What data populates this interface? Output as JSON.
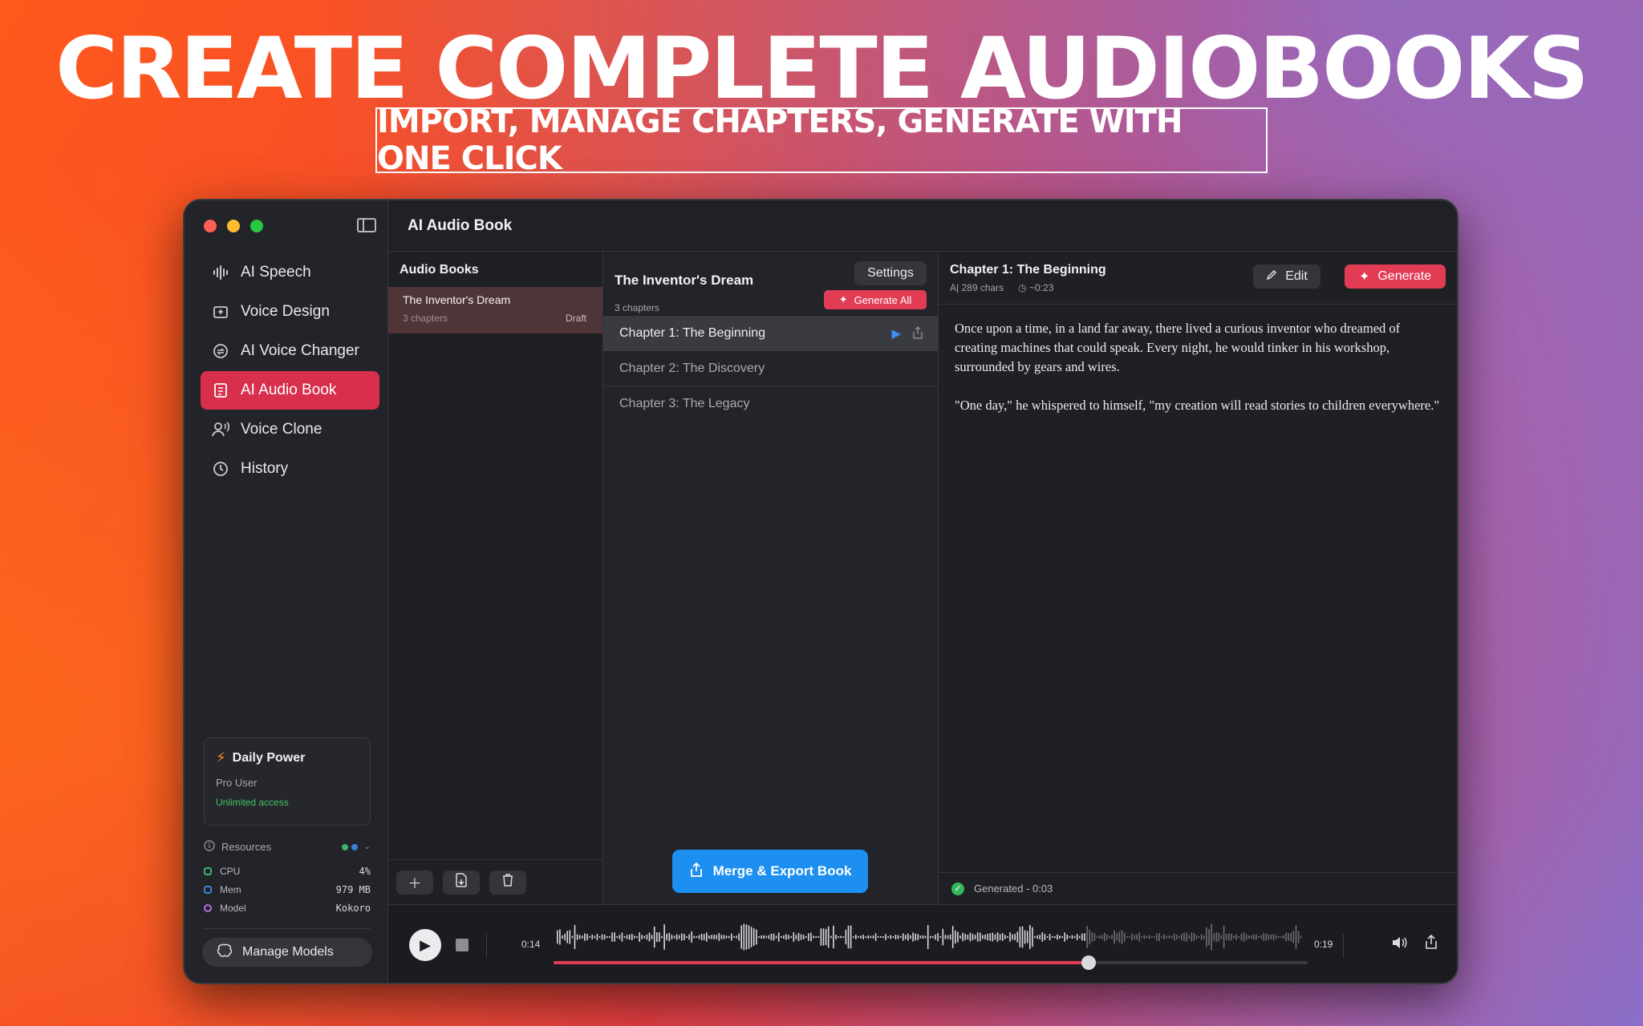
{
  "headline": "CREATE COMPLETE AUDIOBOOKS",
  "subheadline": "IMPORT, MANAGE CHAPTERS, GENERATE WITH ONE CLICK",
  "window": {
    "title": "AI Audio Book"
  },
  "sidebar": {
    "items": [
      {
        "label": "AI Speech",
        "icon": "waveform-icon"
      },
      {
        "label": "Voice Design",
        "icon": "voice-design-icon"
      },
      {
        "label": "AI Voice Changer",
        "icon": "voice-changer-icon"
      },
      {
        "label": "AI Audio Book",
        "icon": "book-icon",
        "active": true
      },
      {
        "label": "Voice Clone",
        "icon": "voice-clone-icon"
      },
      {
        "label": "History",
        "icon": "clock-icon"
      }
    ],
    "power": {
      "title": "Daily Power",
      "user": "Pro User",
      "access": "Unlimited access"
    },
    "resources": {
      "title": "Resources",
      "rows": [
        {
          "label": "CPU",
          "value": "4%",
          "color": "#3cb46e"
        },
        {
          "label": "Mem",
          "value": "979 MB",
          "color": "#3d7fd8"
        },
        {
          "label": "Model",
          "value": "Kokoro",
          "color": "#b26fe0"
        }
      ]
    },
    "manage_models": "Manage Models"
  },
  "books": {
    "title": "Audio Books",
    "items": [
      {
        "name": "The Inventor's Dream",
        "chapters": "3 chapters",
        "status": "Draft"
      }
    ]
  },
  "chapters": {
    "book_title": "The Inventor's Dream",
    "count": "3 chapters",
    "settings": "Settings",
    "generate_all": "Generate All",
    "items": [
      {
        "label": "Chapter 1: The Beginning",
        "active": true
      },
      {
        "label": "Chapter 2: The Discovery"
      },
      {
        "label": "Chapter 3: The Legacy"
      }
    ],
    "merge_export": "Merge & Export Book"
  },
  "detail": {
    "title": "Chapter 1: The Beginning",
    "chars": "289 chars",
    "duration": "~0:23",
    "edit": "Edit",
    "generate": "Generate",
    "paragraph1": "Once upon a time, in a land far away, there lived a curious inventor who dreamed of creating machines that could speak. Every night, he would tinker in his workshop, surrounded by gears and wires.",
    "paragraph2": "\"One day,\" he whispered to himself, \"my creation will read stories to children everywhere.\"",
    "status": "Generated - 0:03"
  },
  "player": {
    "current": "0:14",
    "total": "0:19",
    "progress": 0.71
  },
  "colors": {
    "accent": "#e23c55",
    "primary_blue": "#1c8ff0"
  }
}
